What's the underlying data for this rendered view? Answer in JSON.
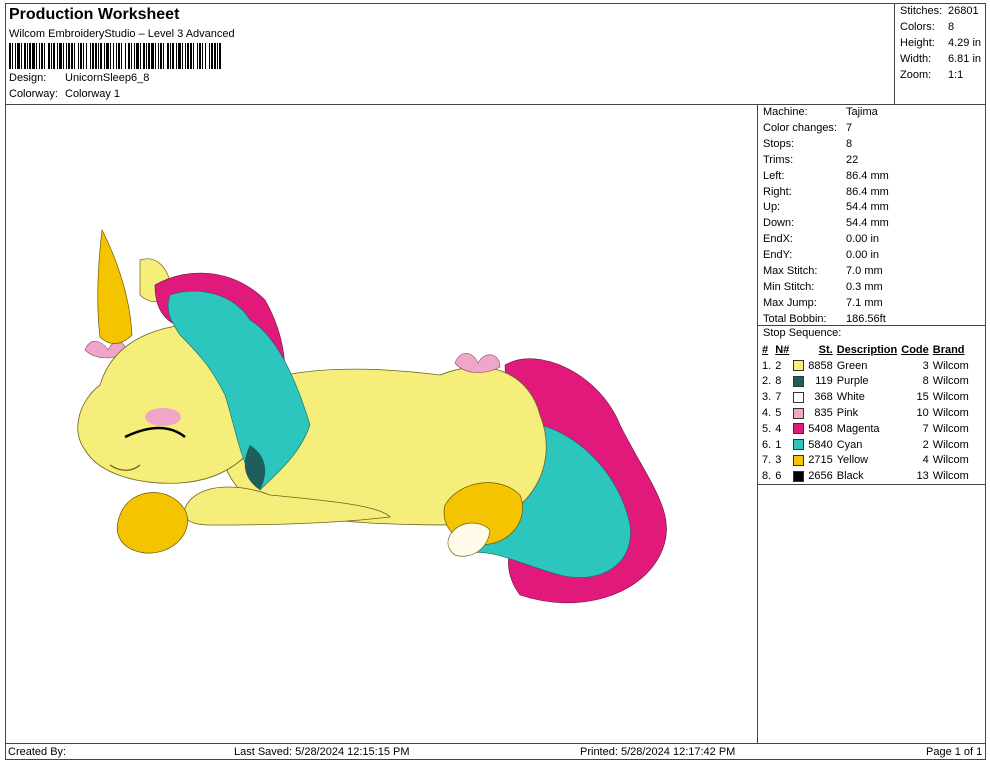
{
  "header": {
    "title": "Production Worksheet",
    "subtitle": "Wilcom EmbroideryStudio – Level 3 Advanced",
    "design_label": "Design:",
    "design_value": "UnicornSleep6_8",
    "colorway_label": "Colorway:",
    "colorway_value": "Colorway 1"
  },
  "stats": [
    {
      "label": "Stitches:",
      "value": "26801"
    },
    {
      "label": "Colors:",
      "value": "8"
    },
    {
      "label": "Height:",
      "value": "4.29 in"
    },
    {
      "label": "Width:",
      "value": "6.81 in"
    },
    {
      "label": "Zoom:",
      "value": "1:1"
    }
  ],
  "machine": [
    {
      "label": "Machine:",
      "value": "Tajima"
    },
    {
      "label": "Color changes:",
      "value": "7"
    },
    {
      "label": "Stops:",
      "value": "8"
    },
    {
      "label": "Trims:",
      "value": "22"
    },
    {
      "label": "Left:",
      "value": "86.4 mm"
    },
    {
      "label": "Right:",
      "value": "86.4 mm"
    },
    {
      "label": "Up:",
      "value": "54.4 mm"
    },
    {
      "label": "Down:",
      "value": "54.4 mm"
    },
    {
      "label": "EndX:",
      "value": "0.00 in"
    },
    {
      "label": "EndY:",
      "value": "0.00 in"
    },
    {
      "label": "Max Stitch:",
      "value": "7.0 mm"
    },
    {
      "label": "Min Stitch:",
      "value": "0.3 mm"
    },
    {
      "label": "Max Jump:",
      "value": "7.1 mm"
    },
    {
      "label": "Total Bobbin:",
      "value": "186.56ft"
    }
  ],
  "sequence": {
    "title": "Stop Sequence:",
    "headers": [
      "#",
      "N#",
      "St.",
      "Description",
      "Code",
      "Brand"
    ],
    "rows": [
      {
        "num": "1.",
        "n": "2",
        "color": "#f5ee7a",
        "st": "8858",
        "desc": "Green",
        "code": "3",
        "brand": "Wilcom"
      },
      {
        "num": "2.",
        "n": "8",
        "color": "#1f5f5b",
        "st": "119",
        "desc": "Purple",
        "code": "8",
        "brand": "Wilcom"
      },
      {
        "num": "3.",
        "n": "7",
        "color": "#ffffff",
        "st": "368",
        "desc": "White",
        "code": "15",
        "brand": "Wilcom"
      },
      {
        "num": "4.",
        "n": "5",
        "color": "#f0a6c8",
        "st": "835",
        "desc": "Pink",
        "code": "10",
        "brand": "Wilcom"
      },
      {
        "num": "5.",
        "n": "4",
        "color": "#e0197a",
        "st": "5408",
        "desc": "Magenta",
        "code": "7",
        "brand": "Wilcom"
      },
      {
        "num": "6.",
        "n": "1",
        "color": "#2cc6bf",
        "st": "5840",
        "desc": "Cyan",
        "code": "2",
        "brand": "Wilcom"
      },
      {
        "num": "7.",
        "n": "3",
        "color": "#f5c400",
        "st": "2715",
        "desc": "Yellow",
        "code": "4",
        "brand": "Wilcom"
      },
      {
        "num": "8.",
        "n": "6",
        "color": "#000000",
        "st": "2656",
        "desc": "Black",
        "code": "13",
        "brand": "Wilcom"
      }
    ]
  },
  "footer": {
    "created": "Created By:",
    "saved": "Last Saved: 5/28/2024 12:15:15 PM",
    "printed": "Printed: 5/28/2024 12:17:42 PM",
    "page": "Page 1 of 1"
  }
}
